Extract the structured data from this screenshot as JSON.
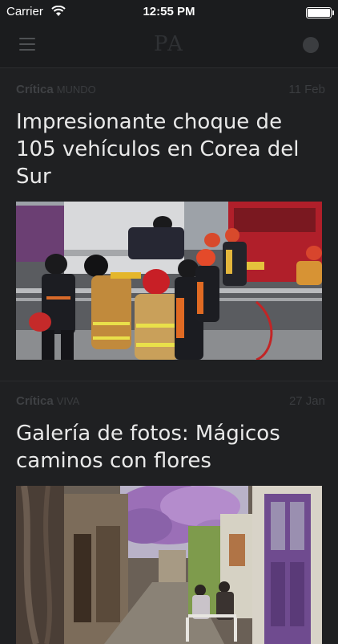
{
  "status_bar": {
    "carrier": "Carrier",
    "time": "12:55 PM"
  },
  "nav": {
    "logo": "PA",
    "menu_icon": "hamburger-menu-icon",
    "profile_icon": "profile-circle-icon"
  },
  "articles": [
    {
      "section": "Crítica",
      "subsection": "MUNDO",
      "date": "11 Feb",
      "headline": "Impresionante choque de 105 vehículos en Corea del Sur",
      "image": "firefighters-rescue-photo"
    },
    {
      "section": "Crítica",
      "subsection": "VIVA",
      "date": "27 Jan",
      "headline": "Galería de fotos: Mágicos caminos con flores",
      "image": "flower-alley-photo"
    }
  ]
}
